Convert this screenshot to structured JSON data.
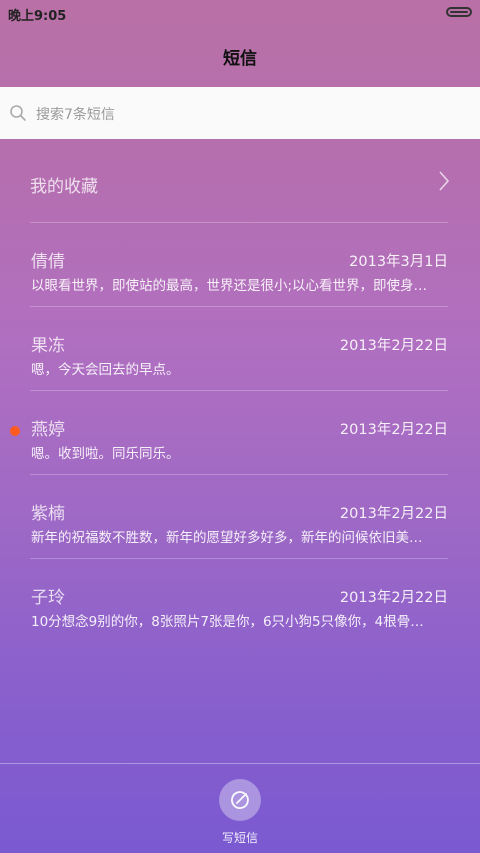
{
  "status_bar": {
    "time": "晚上9:05"
  },
  "header": {
    "title": "短信"
  },
  "search": {
    "placeholder": "搜索7条短信"
  },
  "favorites": {
    "label": "我的收藏"
  },
  "messages": [
    {
      "name": "倩倩",
      "date": "2013年3月1日",
      "preview": "以眼看世界，即使站的最高，世界还是很小;以心看世界，即使身…",
      "unread": false
    },
    {
      "name": "果冻",
      "date": "2013年2月22日",
      "preview": "嗯，今天会回去的早点。",
      "unread": false
    },
    {
      "name": "燕婷",
      "date": "2013年2月22日",
      "preview": "嗯。收到啦。同乐同乐。",
      "unread": true
    },
    {
      "name": "紫楠",
      "date": "2013年2月22日",
      "preview": "新年的祝福数不胜数，新年的愿望好多好多，新年的问候依旧美…",
      "unread": false
    },
    {
      "name": "子玲",
      "date": "2013年2月22日",
      "preview": "10分想念9别的你，8张照片7张是你，6只小狗5只像你，4根骨…",
      "unread": false
    }
  ],
  "compose": {
    "label": "写短信",
    "icon": "compose-icon"
  },
  "colors": {
    "unread_dot": "#ff5a1f",
    "search_bg": "#fafafa"
  }
}
